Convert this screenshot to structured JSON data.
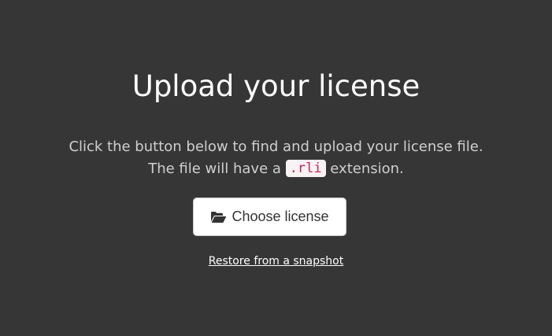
{
  "page": {
    "title": "Upload your license",
    "description_line1": "Click the button below to find and upload your license file.",
    "description_line2_prefix": "The file will have a ",
    "extension_code": ".rli",
    "description_line2_suffix": " extension."
  },
  "choose_button": {
    "label": "Choose license",
    "icon": "folder-open-icon"
  },
  "restore_link": {
    "label": "Restore from a snapshot"
  },
  "colors": {
    "background": "#363636",
    "text": "#ffffff",
    "muted_text": "#cfcfcf",
    "code_text": "#c7254e",
    "code_background": "#f9f2f4",
    "button_background": "#ffffff",
    "button_text": "#333333"
  }
}
